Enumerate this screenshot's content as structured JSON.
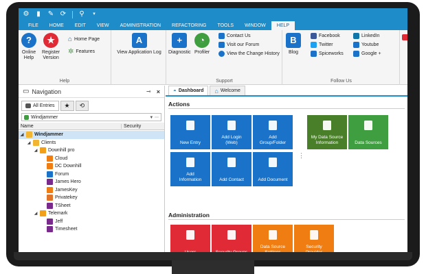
{
  "colors": {
    "accent": "#1e8cc9",
    "tile_blue": "#1a73c8",
    "tile_green": "#3f9e3f",
    "tile_red": "#e02a35",
    "tile_orange": "#f07d11"
  },
  "quick_access": [
    "app-icon",
    "new-icon",
    "edit-icon",
    "refresh-icon",
    "search-icon",
    "dropdown-icon"
  ],
  "menu": {
    "tabs": [
      "FILE",
      "HOME",
      "EDIT",
      "VIEW",
      "ADMINISTRATION",
      "REFACTORING",
      "TOOLS",
      "WINDOW",
      "HELP"
    ],
    "active": "HELP"
  },
  "ribbon": {
    "help_group": {
      "label": "Help",
      "online_help": "Online\nHelp",
      "register_version": "Register\nVersion",
      "home_page": "Home Page",
      "features": "Features"
    },
    "view_app_log": "View Application Log",
    "support_group": {
      "label": "Support",
      "diagnostic": "Diagnostic",
      "profiler": "Profiler",
      "contact_us": "Contact Us",
      "visit_forum": "Visit our Forum",
      "view_change_history": "View the Change History"
    },
    "follow_group": {
      "label": "Follow Us",
      "blog": "Blog",
      "facebook": "Facebook",
      "twitter": "Twitter",
      "spiceworks": "Spiceworks",
      "linkedin": "LinkedIn",
      "youtube": "Youtube",
      "google_plus": "Google +"
    }
  },
  "navigation": {
    "title": "Navigation",
    "tab_all_entries": "All Entries",
    "datasource": "Windjammer",
    "col_name": "Name",
    "col_security": "Security",
    "tree": [
      {
        "label": "Windjammer",
        "depth": 0,
        "icon": "folder-icon",
        "color": "#f2b632",
        "selected": true,
        "expand": "◢"
      },
      {
        "label": "Clients",
        "depth": 1,
        "icon": "folder-icon",
        "color": "#f2b632",
        "expand": "◢"
      },
      {
        "label": "Downhill pro",
        "depth": 2,
        "icon": "contact-icon",
        "color": "#f2a01a",
        "expand": "◢"
      },
      {
        "label": "Cloud",
        "depth": 3,
        "icon": "key-icon",
        "color": "#f07d11",
        "expand": ""
      },
      {
        "label": "DC Downhill",
        "depth": 3,
        "icon": "key-icon",
        "color": "#f07d11",
        "expand": ""
      },
      {
        "label": "Forum",
        "depth": 3,
        "icon": "web-icon",
        "color": "#1a73c8",
        "expand": ""
      },
      {
        "label": "James Hero",
        "depth": 3,
        "icon": "user-icon",
        "color": "#7a2a8c",
        "expand": ""
      },
      {
        "label": "JamesKey",
        "depth": 3,
        "icon": "key-icon",
        "color": "#f07d11",
        "expand": ""
      },
      {
        "label": "Privatekey",
        "depth": 3,
        "icon": "privatekey-icon",
        "color": "#e0752a",
        "expand": ""
      },
      {
        "label": "TSheet",
        "depth": 3,
        "icon": "sheet-icon",
        "color": "#7a2a8c",
        "expand": ""
      },
      {
        "label": "Telemark",
        "depth": 2,
        "icon": "contact-icon",
        "color": "#f2a01a",
        "expand": "◢"
      },
      {
        "label": "Jeff",
        "depth": 3,
        "icon": "user-icon",
        "color": "#7a2a8c",
        "expand": ""
      },
      {
        "label": "Timesheet",
        "depth": 3,
        "icon": "sheet-icon",
        "color": "#7a2a8c",
        "expand": ""
      }
    ]
  },
  "documents": {
    "tabs": [
      "Dashboard",
      "Welcome"
    ],
    "active": "Dashboard",
    "actions_title": "Actions",
    "admin_title": "Administration",
    "actions": [
      {
        "label": "New Entry",
        "color": "blue",
        "icon": "new-entry-icon"
      },
      {
        "label": "Add Login\n(Web)",
        "color": "blue",
        "icon": "globe-icon"
      },
      {
        "label": "Add\nGroup/Folder",
        "color": "blue",
        "icon": "folder-icon"
      },
      {
        "label": "My Data Source\nInformation",
        "color": "dkgreen",
        "icon": "datasource-info-icon"
      },
      {
        "label": "Data Sources",
        "color": "green",
        "icon": "database-icon"
      },
      {
        "label": "Add\nInformation",
        "color": "blue",
        "icon": "id-card-icon"
      },
      {
        "label": "Add Contact",
        "color": "blue",
        "icon": "contact-icon"
      },
      {
        "label": "Add Document",
        "color": "blue",
        "icon": "document-icon"
      }
    ],
    "administration": [
      {
        "label": "Users",
        "color": "red",
        "icon": "user-icon"
      },
      {
        "label": "Security Groups",
        "color": "red",
        "icon": "security-group-icon"
      },
      {
        "label": "Data Source\nSettings",
        "color": "orange",
        "icon": "datasource-settings-icon"
      },
      {
        "label": "Security\nProvider",
        "color": "orange",
        "icon": "security-provider-icon"
      }
    ]
  }
}
